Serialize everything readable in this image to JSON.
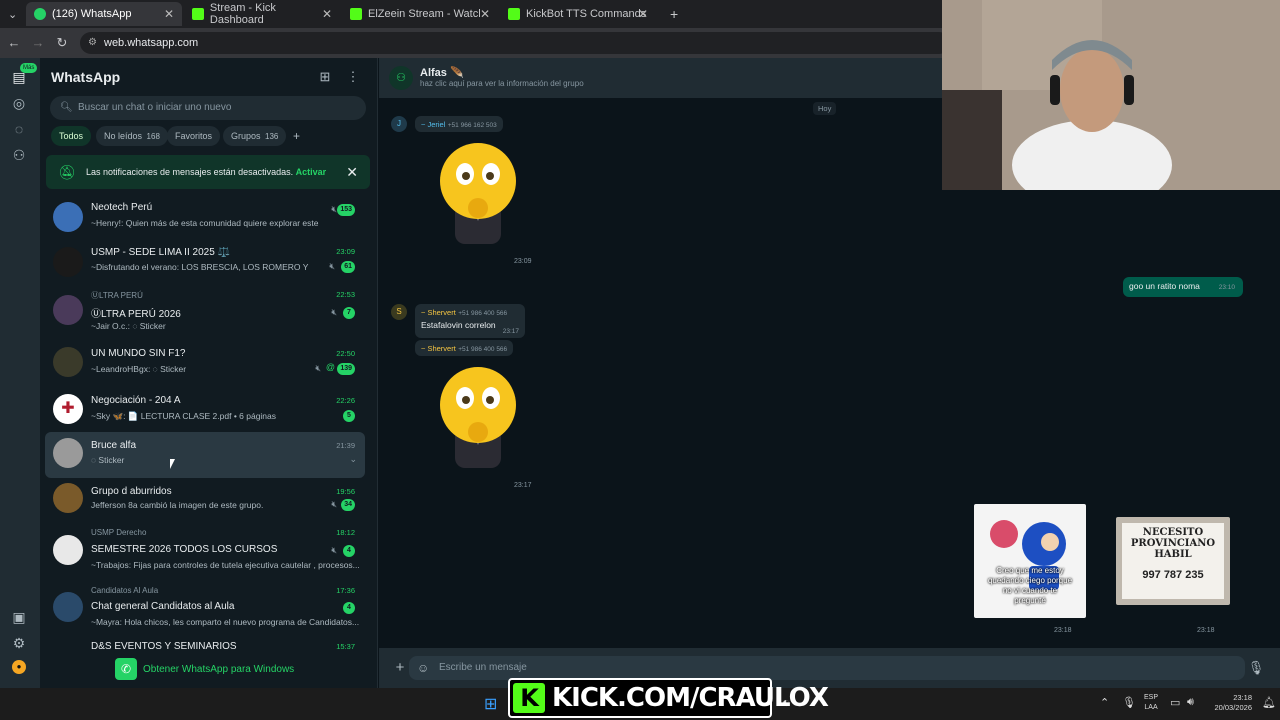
{
  "browser": {
    "tabs": [
      {
        "title": "(126) WhatsApp",
        "active": true,
        "icon_color": "#25d366"
      },
      {
        "title": "Stream - Kick Dashboard",
        "active": false,
        "icon_color": "#53fc18"
      },
      {
        "title": "ElZeein Stream - Watch Live on",
        "active": false,
        "icon_color": "#53fc18"
      },
      {
        "title": "KickBot TTS Commands",
        "active": false,
        "icon_color": "#53fc18"
      }
    ],
    "url": "web.whatsapp.com"
  },
  "rail": {
    "badge": "Más"
  },
  "sidebar": {
    "title": "WhatsApp",
    "search_placeholder": "Buscar un chat o iniciar uno nuevo",
    "filters": [
      {
        "label": "Todos",
        "count": ""
      },
      {
        "label": "No leídos",
        "count": "168"
      },
      {
        "label": "Favoritos",
        "count": ""
      },
      {
        "label": "Grupos",
        "count": "136"
      }
    ],
    "notification": {
      "text": "Las notificaciones de mensajes están desactivadas.",
      "action": "Activar"
    },
    "chats": [
      {
        "prefix": "",
        "name": "Neotech Perú",
        "message": "~Henry!: Quien más de esta comunidad quiere explorar este desafío?",
        "time": "",
        "badge": "153",
        "muted": true
      },
      {
        "prefix": "",
        "name": "USMP - SEDE LIMA II 2025 ⚖️",
        "message": "~Disfrutando el verano: LOS BRESCIA, LOS ROMERO Y LOS ...",
        "time": "23:09",
        "badge": "61",
        "muted": true
      },
      {
        "prefix": "ⓊLTRA PERÚ",
        "name": "ⓊLTRA PERÚ 2026",
        "message": "~Jair O.c.: ◌ Sticker",
        "time": "22:53",
        "badge": "7",
        "muted": true
      },
      {
        "prefix": "",
        "name": "UN MUNDO SIN F1?",
        "message": "~LeandroHBgx: ◌ Sticker",
        "time": "22:50",
        "badge": "139",
        "muted": true
      },
      {
        "prefix": "",
        "name": "Negociación - 204 A",
        "message": "~Sky 🦋: 📄 LECTURA CLASE 2.pdf • 6 páginas",
        "time": "22:26",
        "badge": "5",
        "muted": false
      },
      {
        "prefix": "",
        "name": "Bruce alfa",
        "message": "◌ Sticker",
        "time": "21:39",
        "badge": "",
        "muted": false
      },
      {
        "prefix": "",
        "name": "Grupo d aburridos",
        "message": "Jefferson 8a cambió la imagen de este grupo.",
        "time": "19:56",
        "badge": "34",
        "muted": true
      },
      {
        "prefix": "USMP Derecho",
        "name": "SEMESTRE 2026 TODOS LOS CURSOS",
        "message": "~Trabajos: Fijas para controles de tutela ejecutiva cautelar , procesos...",
        "time": "18:12",
        "badge": "4",
        "muted": true
      },
      {
        "prefix": "Candidatos Al Aula",
        "name": "Chat general Candidatos al Aula",
        "message": "~Mayra: Hola chicos, les comparto el nuevo programa de Candidatos...",
        "time": "17:36",
        "badge": "4",
        "muted": false
      },
      {
        "prefix": "",
        "name": "D&S EVENTOS Y SEMINARIOS",
        "message": "",
        "time": "15:37",
        "badge": "",
        "muted": false
      }
    ],
    "get_app": "Obtener WhatsApp para Windows"
  },
  "chat": {
    "group_name": "Alfas 🪶",
    "group_sub": "haz clic aquí para ver la información del grupo",
    "day": "Hoy",
    "messages": [
      {
        "sender": "~ Jeriel",
        "phone": "+51 966 162 503",
        "avatar": "J",
        "sticker_time": "23:09"
      },
      {
        "sender": "~ Shervert",
        "phone": "+51 986 400 566",
        "avatar": "S",
        "text": "Estafalovin correlon",
        "time": "23:17"
      },
      {
        "sender": "~ Shervert",
        "phone": "+51 986 400 566",
        "sticker_time": "23:17"
      }
    ],
    "outgoing": {
      "text": "goo un ratito noma",
      "time": "23:10"
    },
    "photos": [
      {
        "caption": "Creo que me estoy quedando ciego porque no vi cuando te pregunté",
        "time": "23:18"
      },
      {
        "caption": "NECESITO PROVINCIANO HABIL",
        "phone": "997 787 235",
        "time": "23:18"
      }
    ],
    "composer_placeholder": "Escribe un mensaje"
  },
  "taskbar": {
    "banner": "KICK.COM/CRAULOX",
    "lang": "ESP",
    "lang2": "LAA",
    "time": "23:18",
    "date": "20/03/2026"
  },
  "colors": {
    "accent": "#25d366",
    "kick": "#53fc18",
    "outgoing": "#005c4b"
  }
}
